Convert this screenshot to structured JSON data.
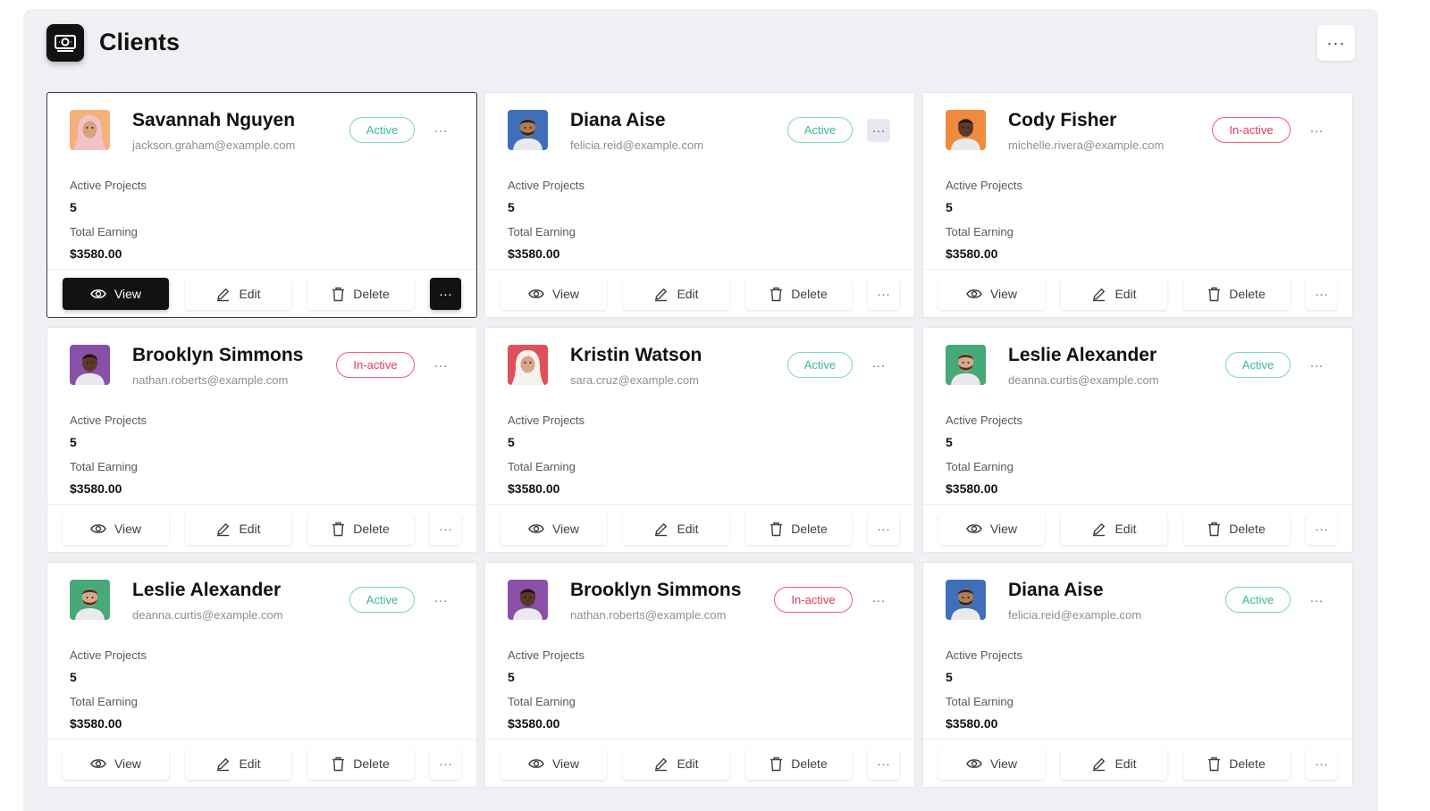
{
  "page": {
    "title": "Clients",
    "more_label": "···"
  },
  "card_labels": {
    "projects_label": "Active Projects",
    "earning_label": "Total Earning",
    "view": "View",
    "edit": "Edit",
    "delete": "Delete",
    "more": "···"
  },
  "colors": {
    "active": "#3cb79d",
    "inactive": "#e23a57",
    "dark_button": "#121212",
    "panel_bg": "#eef0f3"
  },
  "clients": [
    {
      "name": "Savannah Nguyen",
      "email": "jackson.graham@example.com",
      "status": "Active",
      "active_projects": "5",
      "total_earning": "$3580.00",
      "avatar": "avatar-orange-hijab",
      "selected": true
    },
    {
      "name": "Diana Aise",
      "email": "felicia.reid@example.com",
      "status": "Active",
      "active_projects": "5",
      "total_earning": "$3580.00",
      "avatar": "avatar-blue-man",
      "more_highlight": true
    },
    {
      "name": "Cody Fisher",
      "email": "michelle.rivera@example.com",
      "status": "In-active",
      "active_projects": "5",
      "total_earning": "$3580.00",
      "avatar": "avatar-orange-man"
    },
    {
      "name": "Brooklyn Simmons",
      "email": "nathan.roberts@example.com",
      "status": "In-active",
      "active_projects": "5",
      "total_earning": "$3580.00",
      "avatar": "avatar-purple-man"
    },
    {
      "name": "Kristin Watson",
      "email": "sara.cruz@example.com",
      "status": "Active",
      "active_projects": "5",
      "total_earning": "$3580.00",
      "avatar": "avatar-red-hijab"
    },
    {
      "name": "Leslie Alexander",
      "email": "deanna.curtis@example.com",
      "status": "Active",
      "active_projects": "5",
      "total_earning": "$3580.00",
      "avatar": "avatar-green-man"
    },
    {
      "name": "Leslie Alexander",
      "email": "deanna.curtis@example.com",
      "status": "Active",
      "active_projects": "5",
      "total_earning": "$3580.00",
      "avatar": "avatar-green-man"
    },
    {
      "name": "Brooklyn Simmons",
      "email": "nathan.roberts@example.com",
      "status": "In-active",
      "active_projects": "5",
      "total_earning": "$3580.00",
      "avatar": "avatar-purple-man"
    },
    {
      "name": "Diana Aise",
      "email": "felicia.reid@example.com",
      "status": "Active",
      "active_projects": "5",
      "total_earning": "$3580.00",
      "avatar": "avatar-blue-man"
    }
  ]
}
